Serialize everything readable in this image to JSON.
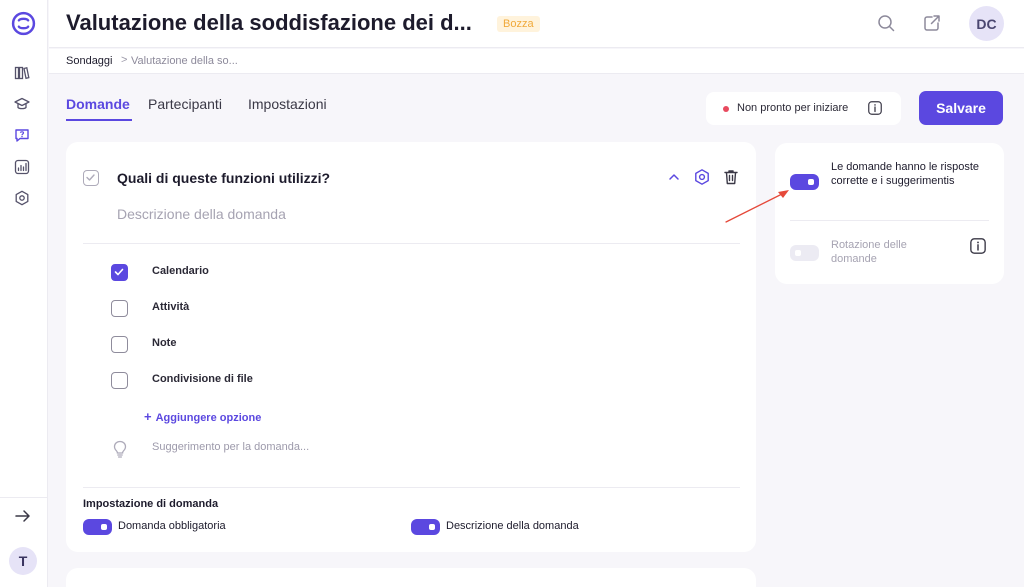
{
  "header": {
    "title": "Valutazione della soddisfazione dei d...",
    "badge": "Bozza",
    "avatar_initials": "DC"
  },
  "breadcrumb": {
    "root": "Sondaggi",
    "separator": ">",
    "current": "Valutazione della so..."
  },
  "tabs": [
    {
      "label": "Domande",
      "active": true
    },
    {
      "label": "Partecipanti",
      "active": false
    },
    {
      "label": "Impostazioni",
      "active": false
    }
  ],
  "status": {
    "text": "Non pronto per iniziare",
    "dot_color": "#e84a5f"
  },
  "save_label": "Salvare",
  "question": {
    "title": "Quali di queste funzioni utilizzi?",
    "description_placeholder": "Descrizione della domanda",
    "options": [
      {
        "label": "Calendario",
        "checked": true
      },
      {
        "label": "Attività",
        "checked": false
      },
      {
        "label": "Note",
        "checked": false
      },
      {
        "label": "Condivisione di file",
        "checked": false
      }
    ],
    "add_option_label": "Aggiungere opzione",
    "hint_placeholder": "Suggerimento per la domanda...",
    "settings_title": "Impostazione di domanda",
    "toggles": [
      {
        "label": "Domanda obbligatoria",
        "on": true
      },
      {
        "label": "Descrizione della domanda",
        "on": true
      }
    ]
  },
  "survey_settings": {
    "correct_answers": {
      "label": "Le domande hanno le risposte corrette e i suggerimentis",
      "on": true
    },
    "rotation": {
      "label": "Rotazione delle domande",
      "on": false
    }
  },
  "sidebar": {
    "user_initial": "T",
    "items": [
      "library-icon",
      "graduation-cap-icon",
      "surveys-icon",
      "analytics-icon",
      "settings-icon"
    ]
  },
  "colors": {
    "accent": "#5b48e0",
    "draft_badge_bg": "#fff3dc",
    "draft_badge_text": "#f0a93a",
    "annotation_arrow": "#e5493a"
  }
}
